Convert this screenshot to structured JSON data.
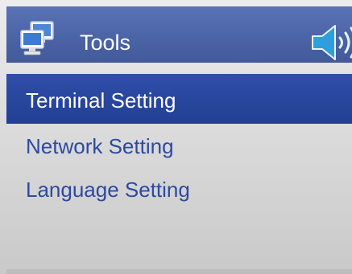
{
  "header": {
    "title": "Tools",
    "left_icon": "computer-network-icon",
    "right_icon": "speaker-volume-icon",
    "background_color": "#4a63a5"
  },
  "menu": {
    "selected_index": 0,
    "items": [
      {
        "label": "Terminal Setting"
      },
      {
        "label": "Network Setting"
      },
      {
        "label": "Language Setting"
      }
    ],
    "selected_color": "#2a469e",
    "text_color": "#2c4aa0"
  }
}
